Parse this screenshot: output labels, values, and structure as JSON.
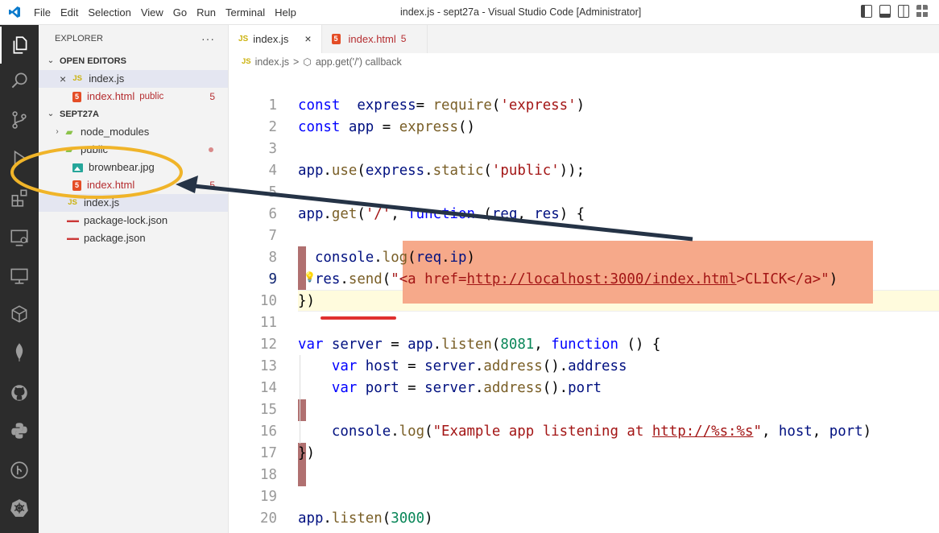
{
  "titlebar": {
    "title": "index.js - sept27a - Visual Studio Code [Administrator]",
    "menu": [
      "File",
      "Edit",
      "Selection",
      "View",
      "Go",
      "Run",
      "Terminal",
      "Help"
    ]
  },
  "sidebar": {
    "header": "EXPLORER",
    "more": "···",
    "open_editors": {
      "title": "OPEN EDITORS",
      "items": [
        {
          "name": "index.js",
          "badge": ""
        },
        {
          "name": "index.html",
          "folder": "public",
          "badge": "5"
        }
      ]
    },
    "project": {
      "title": "SEPT27A",
      "tree": [
        {
          "name": "node_modules"
        },
        {
          "name": "public"
        },
        {
          "name": "brownbear.jpg"
        },
        {
          "name": "index.html",
          "badge": "5"
        },
        {
          "name": "index.js"
        },
        {
          "name": "package-lock.json"
        },
        {
          "name": "package.json"
        }
      ]
    }
  },
  "editor": {
    "tabs": [
      {
        "name": "index.js",
        "close": "×"
      },
      {
        "name": "index.html",
        "badge": "5"
      }
    ],
    "breadcrumb": {
      "file": "index.js",
      "sep": ">",
      "symbol": "app.get('/') callback"
    },
    "current_line": 9,
    "line_numbers": [
      "1",
      "2",
      "3",
      "4",
      "5",
      "6",
      "7",
      "8",
      "9",
      "10",
      "11",
      "12",
      "13",
      "14",
      "15",
      "16",
      "17",
      "18",
      "19",
      "20"
    ]
  },
  "colors": {
    "activity_bar": "#2c2c2c",
    "highlight": "#f6a98a",
    "annotation_circle": "#f0b429",
    "annotation_arrow": "#253346",
    "squiggle": "#e03030"
  }
}
